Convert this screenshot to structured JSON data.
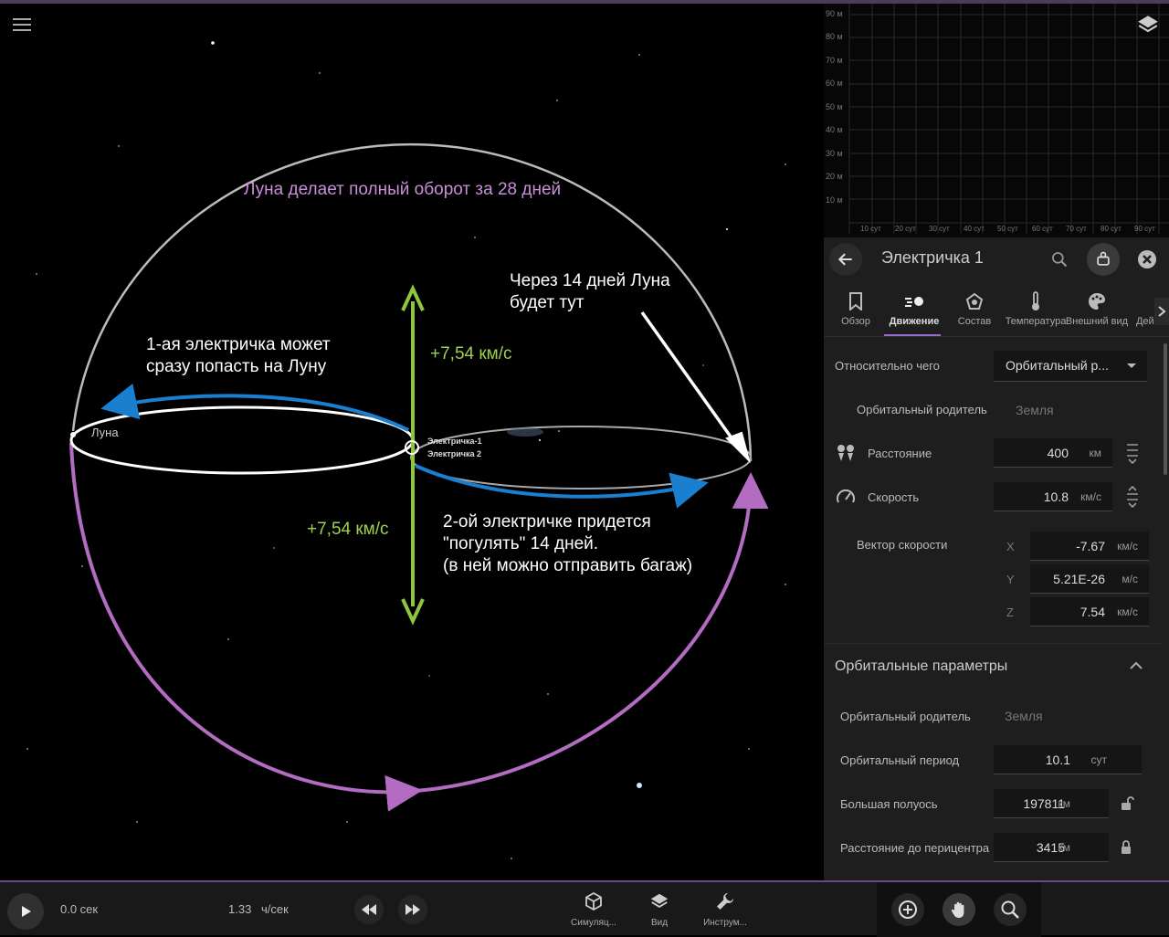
{
  "scene": {
    "title_annotation": "Луна делает полный оборот за 28 дней",
    "first_train_note": [
      "1-ая электричка может",
      "сразу попасть на Луну"
    ],
    "after_14_days_note": [
      "Через 14 дней Луна",
      "будет тут"
    ],
    "velocity_up": "+7,54 км/с",
    "velocity_down": "+7,54 км/с",
    "second_train_note": [
      "2-ой электричке придется",
      "\"погулять\" 14 дней.",
      "(в ней можно отправить багаж)"
    ],
    "moon_label": "Луна",
    "train1_label": "Электричка-1",
    "train2_label": "Электричка 2",
    "colors": {
      "purple": "#b36cc2",
      "blue": "#1b7fd0",
      "green": "#8dc63f"
    }
  },
  "graph": {
    "y_ticks": [
      "90 м",
      "80 м",
      "70 м",
      "60 м",
      "50 м",
      "40 м",
      "30 м",
      "20 м",
      "10 м"
    ],
    "x_ticks": [
      "10 сут",
      "20 сут",
      "30 сут",
      "40 сут",
      "50 сут",
      "60 сут",
      "70 сут",
      "80 сут",
      "90 сут"
    ]
  },
  "panel": {
    "object_name": "Электричка 1",
    "tabs": [
      "Обзор",
      "Движение",
      "Состав",
      "Температура",
      "Внешний вид",
      "Действ"
    ],
    "relative_label": "Относительно чего",
    "relative_value": "Орбитальный р...",
    "orbital_parent_label": "Орбитальный родитель",
    "orbital_parent_value": "Земля",
    "distance_label": "Расстояние",
    "distance_value": "400",
    "distance_unit": "км",
    "speed_label": "Скорость",
    "speed_value": "10.8",
    "speed_unit": "км/с",
    "velocity_vector_label": "Вектор скорости",
    "vx_label": "X",
    "vx_value": "-7.67",
    "vx_unit": "км/с",
    "vy_label": "Y",
    "vy_value": "5.21E-26",
    "vy_unit": "м/с",
    "vz_label": "Z",
    "vz_value": "7.54",
    "vz_unit": "км/с",
    "orbital_section": "Орбитальные параметры",
    "orb_parent_label": "Орбитальный родитель",
    "orb_parent_value": "Земля",
    "period_label": "Орбитальный период",
    "period_value": "10.1",
    "period_unit": "сут",
    "semimajor_label": "Большая полуось",
    "semimajor_value": "197811",
    "semimajor_unit": "км",
    "pericenter_label": "Расстояние до перицентра",
    "pericenter_value": "3415",
    "pericenter_unit": "км"
  },
  "bottom": {
    "time": "0.0 сек",
    "rate_value": "1.33",
    "rate_unit": "ч/сек",
    "simulation_label": "Симуляц...",
    "view_label": "Вид",
    "tools_label": "Инструм..."
  }
}
